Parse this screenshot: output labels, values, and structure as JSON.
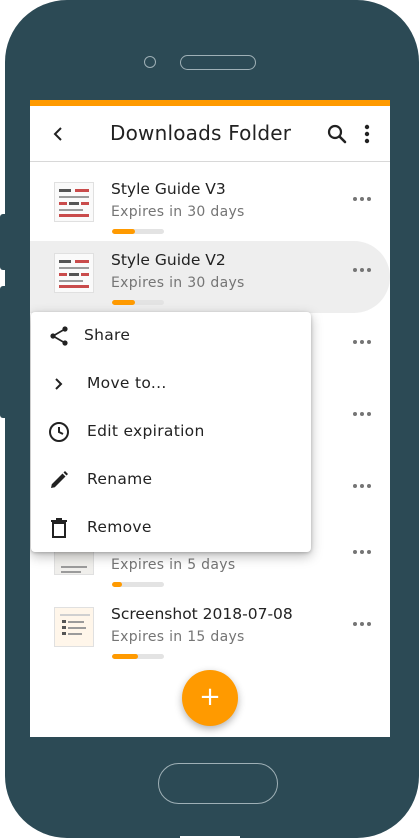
{
  "app_bar": {
    "title": "Downloads Folder",
    "back_icon": "back-chevron-icon",
    "search_icon": "search-icon",
    "overflow_icon": "more-vert-icon"
  },
  "files": [
    {
      "name": "Style Guide V3",
      "expiry": "Expires in 30 days",
      "progress_fraction": 0.45,
      "selected": false
    },
    {
      "name": "Style Guide V2",
      "expiry": "Expires in 30 days",
      "progress_fraction": 0.45,
      "selected": true
    },
    {
      "name": "",
      "expiry": "",
      "progress_fraction": null,
      "selected": false
    },
    {
      "name": "",
      "expiry": "",
      "progress_fraction": null,
      "selected": false
    },
    {
      "name": "",
      "expiry": "Expires in 5 days",
      "progress_fraction": 0.2,
      "selected": false
    },
    {
      "name": "Screenshot 2018-07-08",
      "expiry": "Expires in 15 days",
      "progress_fraction": 0.5,
      "selected": false
    }
  ],
  "context_menu": {
    "items": [
      {
        "label": "Share",
        "icon": "share-icon"
      },
      {
        "label": "Move to...",
        "icon": "chevron-right-icon"
      },
      {
        "label": "Edit expiration",
        "icon": "clock-icon"
      },
      {
        "label": "Rename",
        "icon": "pencil-icon"
      },
      {
        "label": "Remove",
        "icon": "trash-icon"
      }
    ]
  },
  "fab": {
    "label": "+",
    "icon": "add-icon"
  },
  "colors": {
    "accent": "#ff9a00",
    "device": "#2c4a55",
    "selected_row": "#eeeeee",
    "text_primary": "#222222",
    "text_secondary": "#757575"
  }
}
